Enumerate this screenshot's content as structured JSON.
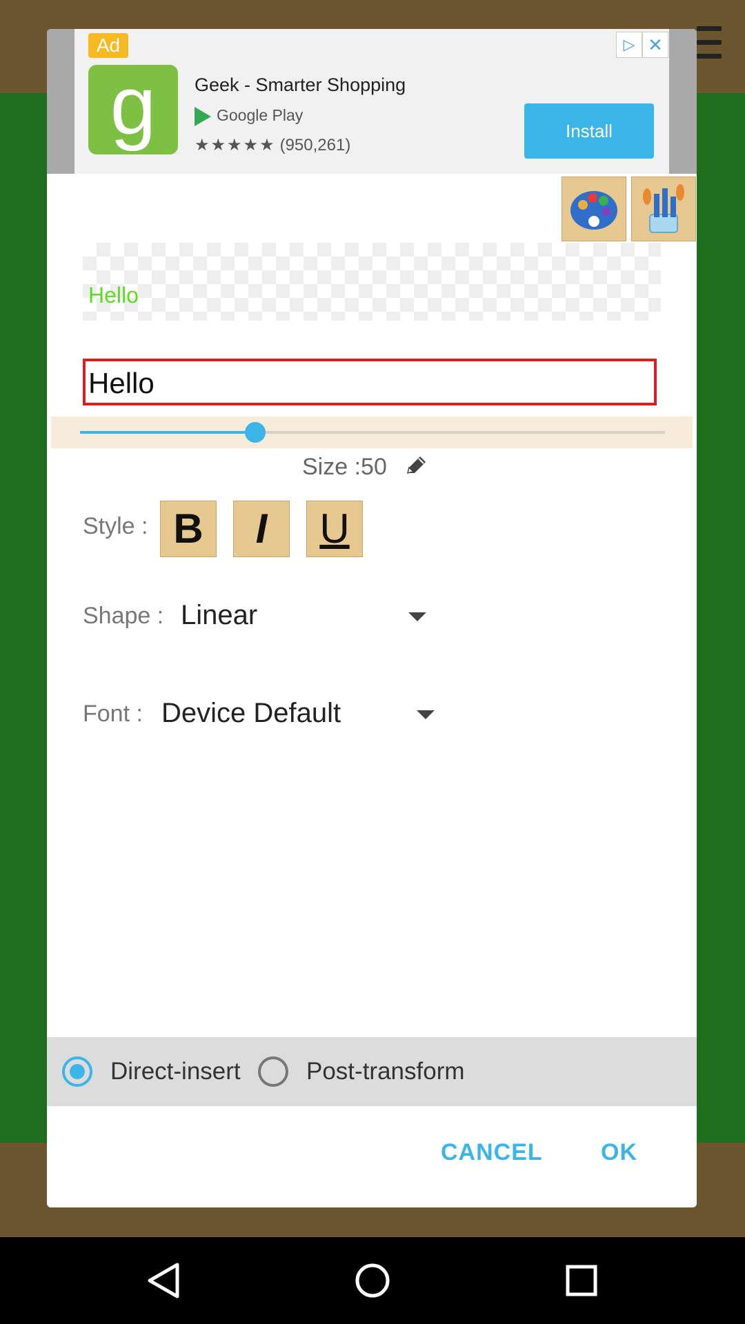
{
  "ad": {
    "badge": "Ad",
    "title": "Geek - Smarter Shopping",
    "store": "Google Play",
    "stars": "★★★★★",
    "rating_count": "(950,261)",
    "install_label": "Install"
  },
  "preview": {
    "text": "Hello",
    "color": "#5fdc22"
  },
  "text_input": {
    "value": "Hello"
  },
  "size": {
    "label": "Size :50",
    "value": 50,
    "fraction": 0.3
  },
  "style": {
    "label": "Style :",
    "bold": "B",
    "italic": "I",
    "underline": "U"
  },
  "shape": {
    "label": "Shape :",
    "value": "Linear"
  },
  "font": {
    "label": "Font :",
    "value": "Device Default"
  },
  "insert_mode": {
    "options": [
      {
        "label": "Direct-insert",
        "selected": true
      },
      {
        "label": "Post-transform",
        "selected": false
      }
    ]
  },
  "actions": {
    "cancel": "CANCEL",
    "ok": "OK"
  },
  "colors": {
    "accent": "#3bb5e8",
    "input_border": "#d82020",
    "wood": "#e8c891"
  }
}
